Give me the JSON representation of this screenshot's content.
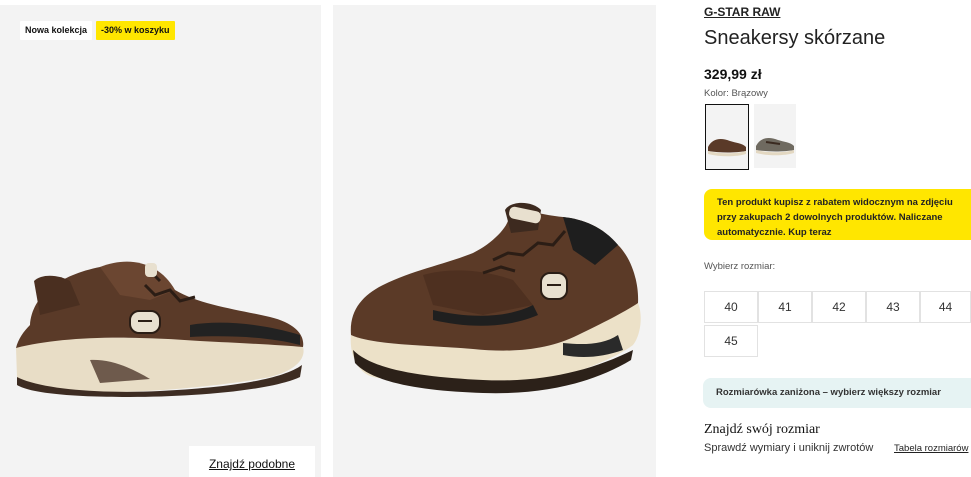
{
  "gallery": {
    "badge_new": "Nowa kolekcja",
    "badge_sale": "-30% w koszyku",
    "find_similar": "Znajdź podobne"
  },
  "product": {
    "brand": "G-STAR RAW",
    "title": "Sneakersy skórzane",
    "price": "329,99 zł",
    "color_label": "Kolor: Brązowy",
    "promo_lines": [
      "Ten produkt kupisz z rabatem widocznym na zdjęciu",
      "przy zakupach 2 dowolnych produktów. Naliczane",
      "automatycznie. Kup teraz"
    ],
    "size_label": "Wybierz rozmiar:",
    "sizes": [
      "40",
      "41",
      "42",
      "43",
      "44",
      "45"
    ],
    "size_note": "Rozmiarówka zaniżona – wybierz większy rozmiar",
    "find_size_title": "Znajdź swój rozmiar",
    "find_size_desc": "Sprawdź wymiary i uniknij zwrotów",
    "size_table_link": "Tabela rozmiarów"
  },
  "colors": {
    "accent_yellow": "#ffe600",
    "info_bg": "#e6f3f3",
    "image_bg": "#f3f3f3"
  }
}
